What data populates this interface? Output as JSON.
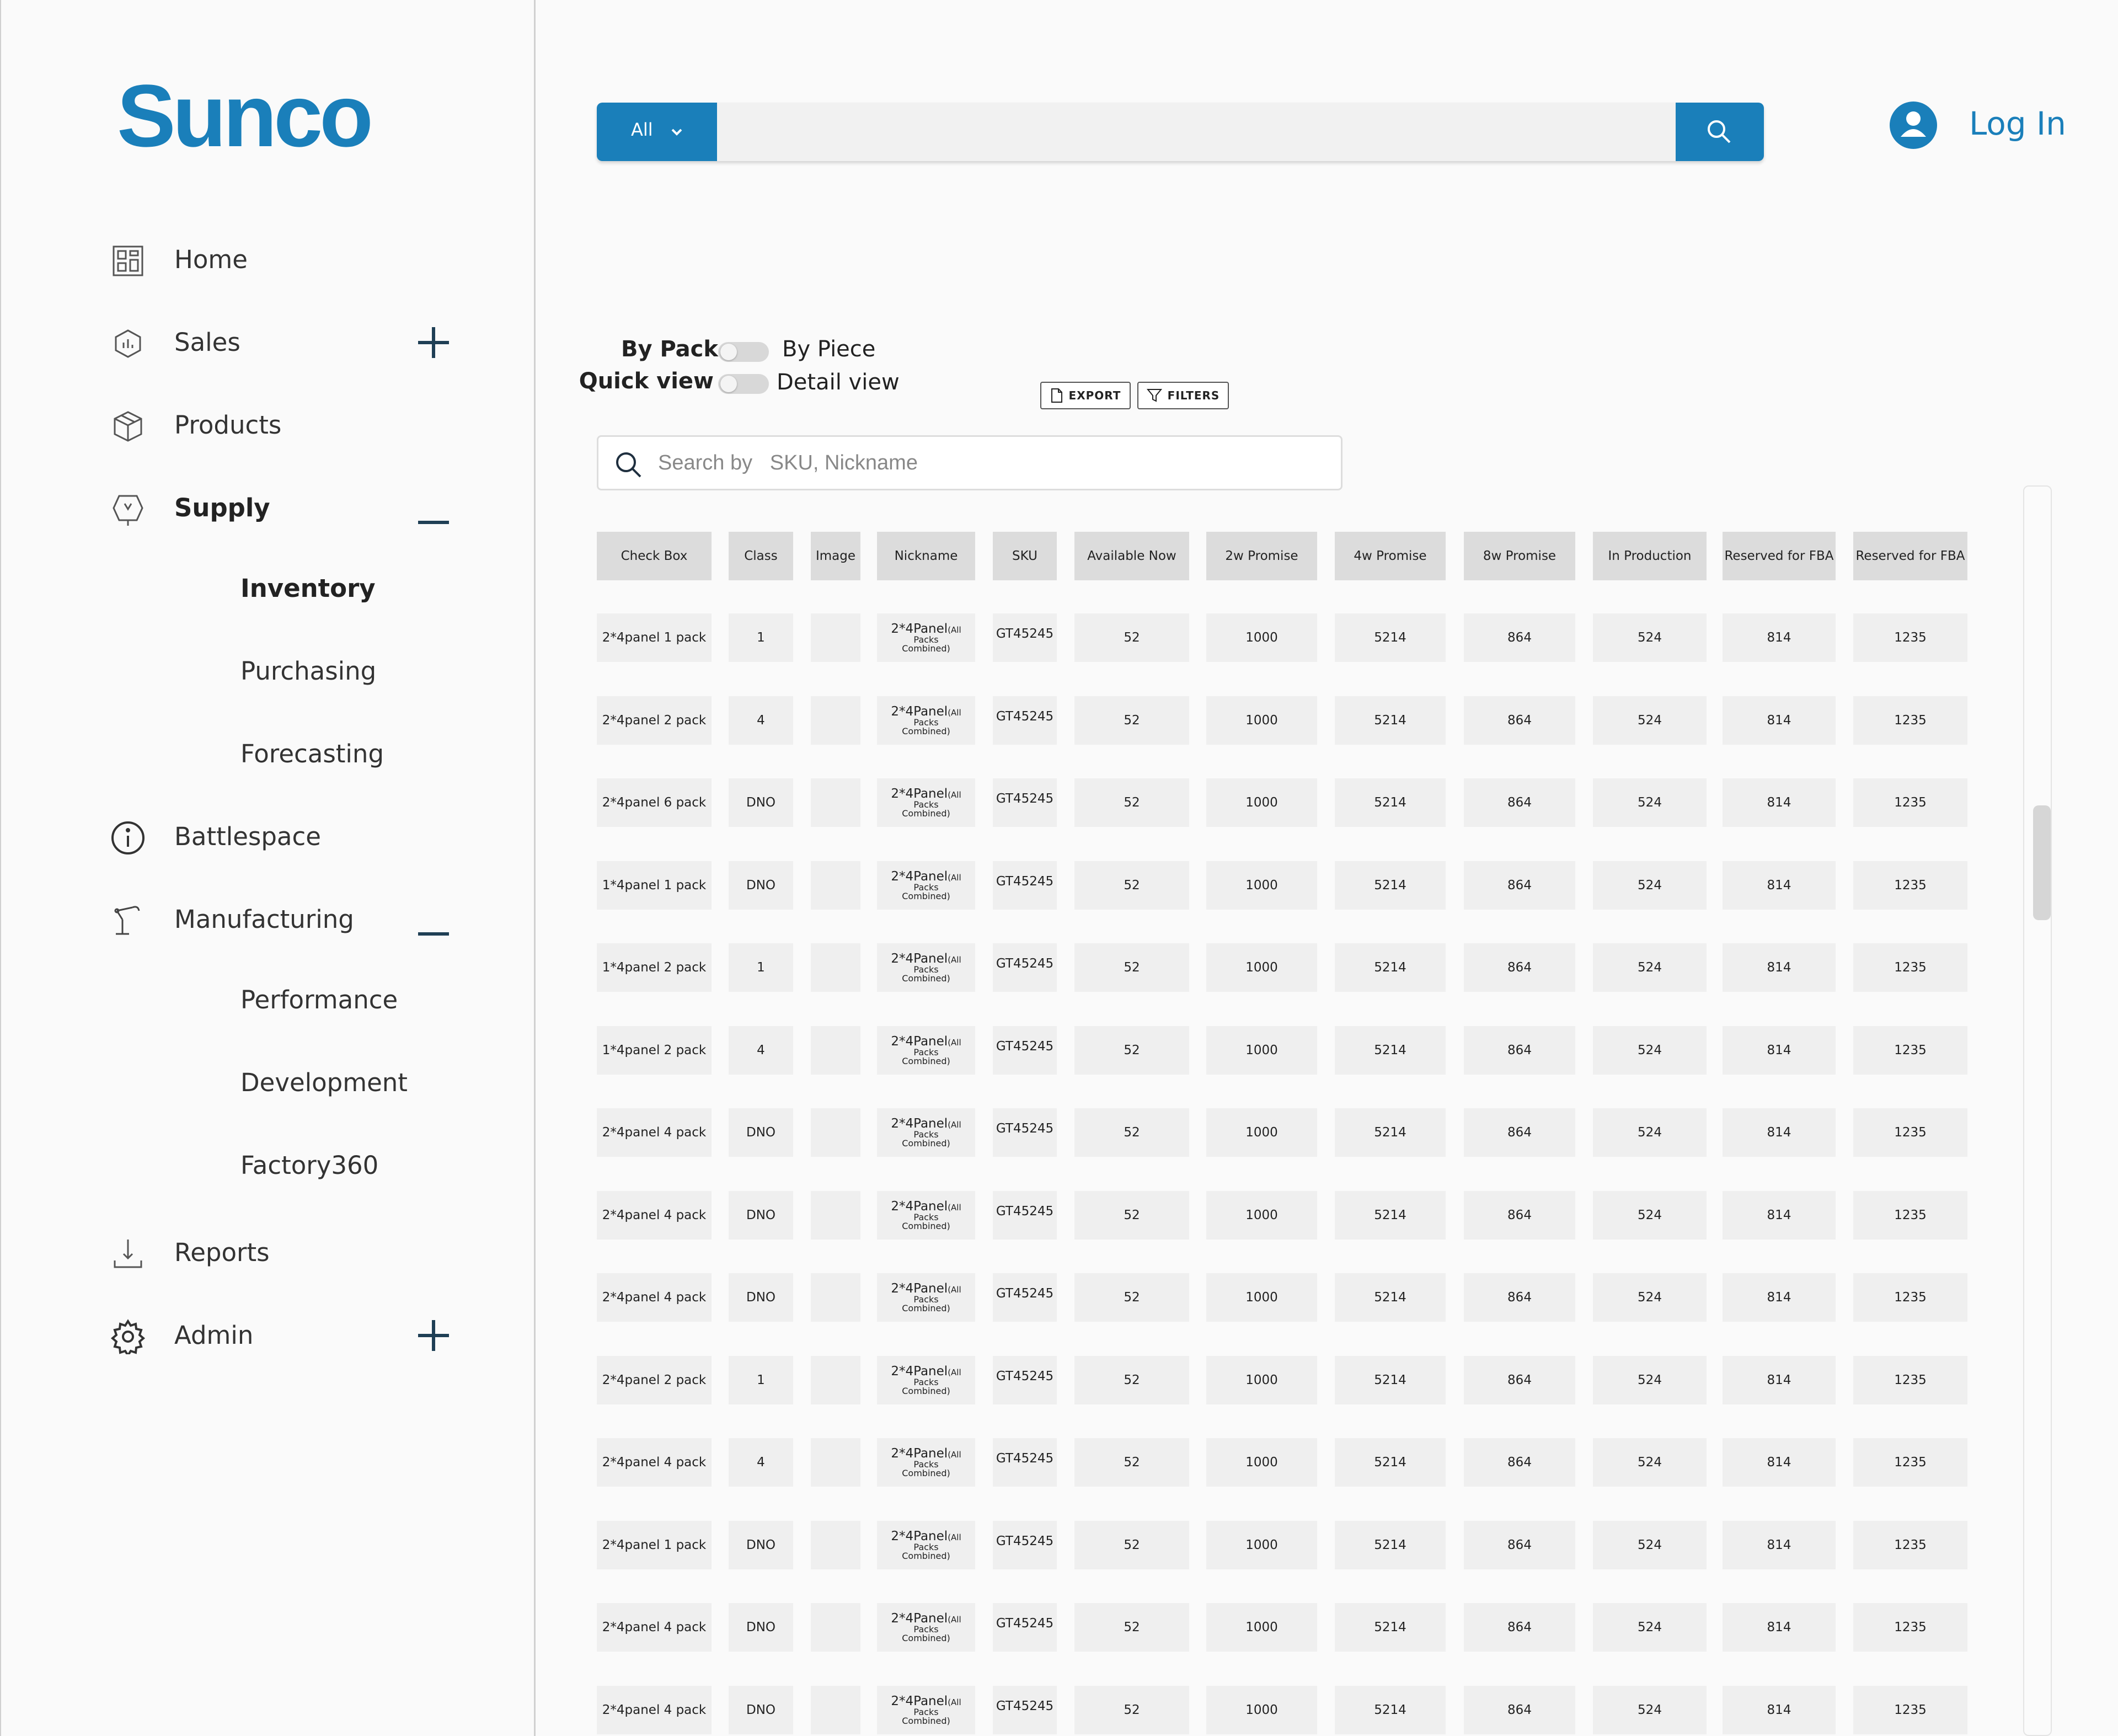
{
  "app": {
    "brand": "Sunco",
    "accent_color": "#1a7fba"
  },
  "sidebar": {
    "items": [
      {
        "label": "Home",
        "icon": "dashboard-icon",
        "bold": false,
        "toggle": ""
      },
      {
        "label": "Sales",
        "icon": "sales-icon",
        "bold": false,
        "toggle": "plus"
      },
      {
        "label": "Products",
        "icon": "box-icon",
        "bold": false,
        "toggle": ""
      },
      {
        "label": "Supply",
        "icon": "supply-icon",
        "bold": true,
        "toggle": "minus"
      },
      {
        "label": "Battlespace",
        "icon": "info-icon",
        "bold": false,
        "toggle": ""
      },
      {
        "label": "Manufacturing",
        "icon": "robot-arm-icon",
        "bold": false,
        "toggle": "minus"
      },
      {
        "label": "Reports",
        "icon": "download-icon",
        "bold": false,
        "toggle": ""
      },
      {
        "label": "Admin",
        "icon": "gear-icon",
        "bold": false,
        "toggle": "plus"
      }
    ],
    "supply_sub": [
      "Inventory",
      "Purchasing",
      "Forecasting"
    ],
    "manufacturing_sub": [
      "Performance",
      "Development",
      "Factory360"
    ]
  },
  "header": {
    "search_scope": "All",
    "search_value": "",
    "login_label": "Log In"
  },
  "view_toggles": {
    "pack_left": "By Pack",
    "pack_right": "By Piece",
    "view_left": "Quick view",
    "view_right": "Detail view"
  },
  "toolbar": {
    "export_label": "EXPORT",
    "filters_label": "FILTERS"
  },
  "table_search": {
    "label": "Search by",
    "placeholder": "SKU, Nickname"
  },
  "table": {
    "columns": [
      "Check Box",
      "Class",
      "Image",
      "Nickname",
      "SKU",
      "Available Now",
      "2w Promise",
      "4w Promise",
      "8w Promise",
      "In Production",
      "Reserved for FBA",
      "Reserved for FBA"
    ],
    "nickname": {
      "main": "2*4Panel",
      "small": "(All",
      "line2": "Packs",
      "line3": "Combined)"
    },
    "rows": [
      {
        "check": "2*4panel 1 pack",
        "class": "1",
        "sku": "GT45245",
        "avail": "52",
        "w2": "1000",
        "w4": "5214",
        "w8": "864",
        "prod": "524",
        "fba1": "814",
        "fba2": "1235"
      },
      {
        "check": "2*4panel 2 pack",
        "class": "4",
        "sku": "GT45245",
        "avail": "52",
        "w2": "1000",
        "w4": "5214",
        "w8": "864",
        "prod": "524",
        "fba1": "814",
        "fba2": "1235"
      },
      {
        "check": "2*4panel 6 pack",
        "class": "DNO",
        "sku": "GT45245",
        "avail": "52",
        "w2": "1000",
        "w4": "5214",
        "w8": "864",
        "prod": "524",
        "fba1": "814",
        "fba2": "1235"
      },
      {
        "check": "1*4panel 1 pack",
        "class": "DNO",
        "sku": "GT45245",
        "avail": "52",
        "w2": "1000",
        "w4": "5214",
        "w8": "864",
        "prod": "524",
        "fba1": "814",
        "fba2": "1235"
      },
      {
        "check": "1*4panel 2 pack",
        "class": "1",
        "sku": "GT45245",
        "avail": "52",
        "w2": "1000",
        "w4": "5214",
        "w8": "864",
        "prod": "524",
        "fba1": "814",
        "fba2": "1235"
      },
      {
        "check": "1*4panel 2 pack",
        "class": "4",
        "sku": "GT45245",
        "avail": "52",
        "w2": "1000",
        "w4": "5214",
        "w8": "864",
        "prod": "524",
        "fba1": "814",
        "fba2": "1235"
      },
      {
        "check": "2*4panel 4 pack",
        "class": "DNO",
        "sku": "GT45245",
        "avail": "52",
        "w2": "1000",
        "w4": "5214",
        "w8": "864",
        "prod": "524",
        "fba1": "814",
        "fba2": "1235"
      },
      {
        "check": "2*4panel 4 pack",
        "class": "DNO",
        "sku": "GT45245",
        "avail": "52",
        "w2": "1000",
        "w4": "5214",
        "w8": "864",
        "prod": "524",
        "fba1": "814",
        "fba2": "1235"
      },
      {
        "check": "2*4panel 4 pack",
        "class": "DNO",
        "sku": "GT45245",
        "avail": "52",
        "w2": "1000",
        "w4": "5214",
        "w8": "864",
        "prod": "524",
        "fba1": "814",
        "fba2": "1235"
      },
      {
        "check": "2*4panel 2 pack",
        "class": "1",
        "sku": "GT45245",
        "avail": "52",
        "w2": "1000",
        "w4": "5214",
        "w8": "864",
        "prod": "524",
        "fba1": "814",
        "fba2": "1235"
      },
      {
        "check": "2*4panel 4 pack",
        "class": "4",
        "sku": "GT45245",
        "avail": "52",
        "w2": "1000",
        "w4": "5214",
        "w8": "864",
        "prod": "524",
        "fba1": "814",
        "fba2": "1235"
      },
      {
        "check": "2*4panel 1 pack",
        "class": "DNO",
        "sku": "GT45245",
        "avail": "52",
        "w2": "1000",
        "w4": "5214",
        "w8": "864",
        "prod": "524",
        "fba1": "814",
        "fba2": "1235"
      },
      {
        "check": "2*4panel 4 pack",
        "class": "DNO",
        "sku": "GT45245",
        "avail": "52",
        "w2": "1000",
        "w4": "5214",
        "w8": "864",
        "prod": "524",
        "fba1": "814",
        "fba2": "1235"
      },
      {
        "check": "2*4panel 4 pack",
        "class": "DNO",
        "sku": "GT45245",
        "avail": "52",
        "w2": "1000",
        "w4": "5214",
        "w8": "864",
        "prod": "524",
        "fba1": "814",
        "fba2": "1235"
      }
    ]
  }
}
